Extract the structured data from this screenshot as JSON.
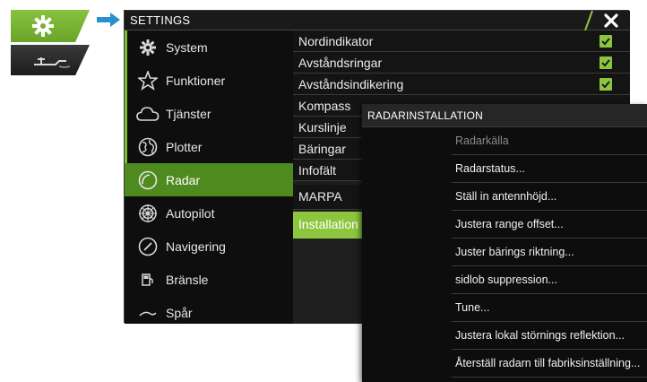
{
  "window": {
    "title": "SETTINGS"
  },
  "sidebar": {
    "items": [
      {
        "label": "System",
        "icon": "gear-icon"
      },
      {
        "label": "Funktioner",
        "icon": "star-icon"
      },
      {
        "label": "Tjänster",
        "icon": "cloud-icon"
      },
      {
        "label": "Plotter",
        "icon": "globe-icon"
      },
      {
        "label": "Radar",
        "icon": "radar-icon",
        "active": true
      },
      {
        "label": "Autopilot",
        "icon": "helm-icon"
      },
      {
        "label": "Navigering",
        "icon": "compass-icon"
      },
      {
        "label": "Bränsle",
        "icon": "fuel-icon"
      },
      {
        "label": "Spår",
        "icon": "track-icon"
      }
    ]
  },
  "settings_list": {
    "rows": [
      {
        "label": "Nordindikator",
        "checked": true
      },
      {
        "label": "Avståndsringar",
        "checked": true
      },
      {
        "label": "Avståndsindikering",
        "checked": true
      },
      {
        "label": "Kompass"
      },
      {
        "label": "Kurslinje"
      },
      {
        "label": "Bäringar"
      },
      {
        "label": "Infofält"
      },
      {
        "label": "MARPA"
      },
      {
        "label": "Installation"
      }
    ]
  },
  "popup": {
    "title": "RADARINSTALLATION",
    "items": [
      {
        "label": "Radarkälla",
        "disabled": true
      },
      {
        "label": "Radarstatus..."
      },
      {
        "label": "Ställ in antennhöjd..."
      },
      {
        "label": "Justera range offset..."
      },
      {
        "label": "Juster bärings riktning..."
      },
      {
        "label": "sidlob suppression..."
      },
      {
        "label": "Tune..."
      },
      {
        "label": "Justera lokal störnings reflektion..."
      },
      {
        "label": "Återställ radarn till fabriksinställning..."
      }
    ]
  },
  "colors": {
    "accent": "#8cc63f",
    "active_sidebar": "#4f8a1f",
    "arrow": "#2a8fd0",
    "background_dark": "#141414"
  }
}
